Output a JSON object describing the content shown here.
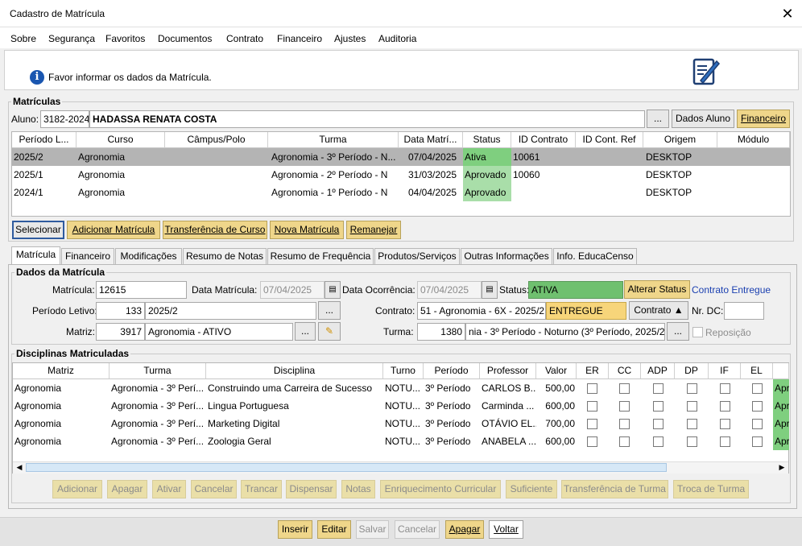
{
  "window": {
    "title": "Cadastro de Matrícula",
    "close": "✕"
  },
  "menu": [
    "Sobre",
    "Segurança",
    "Favoritos",
    "Documentos",
    "Contrato",
    "Financeiro",
    "Ajustes",
    "Auditoria"
  ],
  "info": {
    "text": "Favor informar os dados da Matrícula."
  },
  "matriculas": {
    "legend": "Matrículas",
    "aluno_label": "Aluno:",
    "aluno_id": "3182-2024",
    "aluno_nome": "HADASSA RENATA COSTA",
    "ellipsis": "...",
    "dados_aluno": "Dados Aluno",
    "financeiro": "Financeiro",
    "columns": [
      "Período L...",
      "Curso",
      "Câmpus/Polo",
      "Turma",
      "Data Matrí...",
      "Status",
      "ID Contrato",
      "ID Cont. Ref",
      "Origem",
      "Módulo"
    ],
    "rows": [
      [
        "2025/2",
        "Agronomia",
        "",
        "Agronomia - 3º Período - N...",
        "07/04/2025",
        "Ativa",
        "10061",
        "",
        "DESKTOP",
        ""
      ],
      [
        "2025/1",
        "Agronomia",
        "",
        "Agronomia - 2º Período - N",
        "31/03/2025",
        "Aprovado",
        "10060",
        "",
        "DESKTOP",
        ""
      ],
      [
        "2024/1",
        "Agronomia",
        "",
        "Agronomia - 1º Período - N",
        "04/04/2025",
        "Aprovado",
        "",
        "",
        "DESKTOP",
        ""
      ]
    ],
    "status_color": "#8fd48f",
    "buttons": {
      "selecionar": "Selecionar",
      "adicionar": "Adicionar Matrícula",
      "transferencia": "Transferência de Curso",
      "nova": "Nova Matrícula",
      "remanejar": "Remanejar"
    }
  },
  "tabs": [
    "Matrícula",
    "Financeiro",
    "Modificações",
    "Resumo de Notas",
    "Resumo de Frequência",
    "Produtos/Serviços",
    "Outras Informações",
    "Info. EducaCenso"
  ],
  "dados": {
    "legend": "Dados da Matrícula",
    "matricula_label": "Matrícula:",
    "matricula": "12615",
    "data_matricula_label": "Data Matrícula:",
    "data_matricula": "07/04/2025",
    "data_ocorrencia_label": "Data Ocorrência:",
    "data_ocorrencia": "07/04/2025",
    "status_label": "Status:",
    "status": "ATIVA",
    "alterar_status": "Alterar Status",
    "contrato_entregue": "Contrato Entregue",
    "periodo_label": "Período Letivo:",
    "periodo_id": "133",
    "periodo": "2025/2",
    "contrato_label": "Contrato:",
    "contrato": "51 - Agronomia - 6X - 2025/2",
    "contrato_status": "ENTREGUE",
    "contrato_btn": "Contrato ▲",
    "nr_dc_label": "Nr. DC:",
    "nr_dc": "",
    "matriz_label": "Matriz:",
    "matriz_id": "3917",
    "matriz": "Agronomia - ATIVO",
    "turma_label": "Turma:",
    "turma_id": "1380",
    "turma": "nia - 3º Período - Noturno (3º Período, 2025/2)",
    "reposicao": "Reposição"
  },
  "disciplinas": {
    "legend": "Disciplinas Matriculadas",
    "columns": [
      "Matriz",
      "Turma",
      "Disciplina",
      "Turno",
      "Período",
      "Professor",
      "Valor",
      "ER",
      "CC",
      "ADP",
      "DP",
      "IF",
      "EL"
    ],
    "rows": [
      [
        "Agronomia",
        "Agronomia - 3º Perí...",
        "Construindo uma Carreira de Sucesso",
        "NOTU...",
        "3º Período",
        "CARLOS B...",
        "500,00",
        "Apr"
      ],
      [
        "Agronomia",
        "Agronomia - 3º Perí...",
        "Lingua Portuguesa",
        "NOTU...",
        "3º Período",
        "Carminda ...",
        "600,00",
        "Apr"
      ],
      [
        "Agronomia",
        "Agronomia - 3º Perí...",
        "Marketing Digital",
        "NOTU...",
        "3º Período",
        "OTÁVIO EL...",
        "700,00",
        "Apr"
      ],
      [
        "Agronomia",
        "Agronomia - 3º Perí...",
        "Zoologia Geral",
        "NOTU...",
        "3º Período",
        "ANABELA ...",
        "600,00",
        "Apr"
      ]
    ],
    "buttons": [
      "Adicionar",
      "Apagar",
      "Ativar",
      "Cancelar",
      "Trancar",
      "Dispensar",
      "Notas",
      "Enriquecimento Curricular",
      "Suficiente",
      "Transferência de Turma",
      "Troca de Turma"
    ]
  },
  "footer": [
    "Inserir",
    "Editar",
    "Salvar",
    "Cancelar",
    "Apagar",
    "Voltar"
  ]
}
